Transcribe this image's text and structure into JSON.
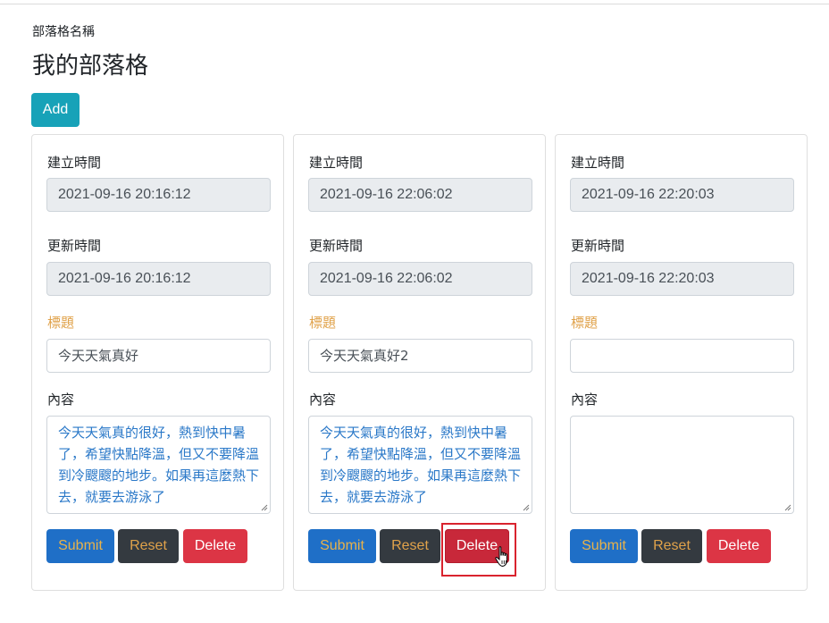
{
  "header": {
    "blog_name_label": "部落格名稱",
    "blog_title": "我的部落格",
    "add_label": "Add"
  },
  "labels": {
    "created": "建立時間",
    "updated": "更新時間",
    "title": "標題",
    "content": "內容"
  },
  "buttons": {
    "submit": "Submit",
    "reset": "Reset",
    "delete": "Delete"
  },
  "posts": [
    {
      "created": "2021-09-16 20:16:12",
      "updated": "2021-09-16 20:16:12",
      "title": "今天天氣真好",
      "content": "今天天氣真的很好，熱到快中暑了，希望快點降溫，但又不要降溫到冷颼颼的地步。如果再這麼熱下去，就要去游泳了"
    },
    {
      "created": "2021-09-16 22:06:02",
      "updated": "2021-09-16 22:06:02",
      "title": "今天天氣真好2",
      "content": "今天天氣真的很好，熱到快中暑了，希望快點降溫，但又不要降溫到冷颼颼的地步。如果再這麼熱下去，就要去游泳了"
    },
    {
      "created": "2021-09-16 22:20:03",
      "updated": "2021-09-16 22:20:03",
      "title": "",
      "content": ""
    }
  ],
  "colors": {
    "add": "#17a2b8",
    "submit": "#1f6fc7",
    "reset": "#343a40",
    "delete": "#dc3545",
    "title_label": "#e0a24a",
    "content_text": "#2a78c8",
    "highlight": "#d9232e"
  },
  "icons": {
    "cursor": "hand-pointer-icon",
    "resize": "resize-grip-icon"
  }
}
